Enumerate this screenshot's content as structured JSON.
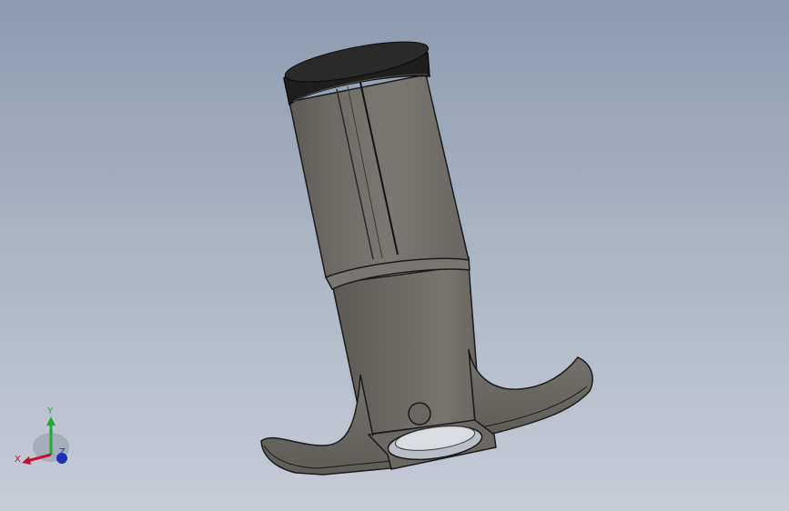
{
  "viewport": {
    "background_top": "#8b9bb0",
    "background_bottom": "#c7ccd6"
  },
  "model": {
    "body_color": "#6f6c67",
    "cap_color": "#1b1b1b"
  },
  "triad": {
    "x_label": "X",
    "y_label": "Y",
    "z_label": "Z",
    "x_color": "#c8102e",
    "y_color": "#1fa83a",
    "z_color": "#1f2fb8"
  }
}
